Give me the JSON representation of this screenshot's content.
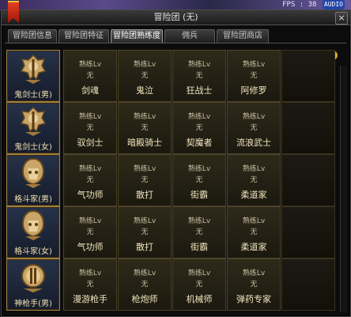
{
  "hud": {
    "fps_label": "FPS : 38",
    "mic_label": "AUDIO"
  },
  "window": {
    "title": "冒险团 (无)",
    "close_glyph": "×",
    "help_glyph": "?"
  },
  "tabs": [
    {
      "label": "冒险团信息",
      "active": false
    },
    {
      "label": "冒险团特征",
      "active": false
    },
    {
      "label": "冒险团熟练度",
      "active": true
    },
    {
      "label": "佣兵",
      "active": false
    },
    {
      "label": "冒险团商店",
      "active": false
    }
  ],
  "lv_label": "熟练Lv",
  "rows": [
    {
      "character": "鬼剑士(男)",
      "emblem": "slayer-emblem-icon",
      "jobs": [
        {
          "name": "剑魂",
          "value": "无"
        },
        {
          "name": "鬼泣",
          "value": "无"
        },
        {
          "name": "狂战士",
          "value": "无"
        },
        {
          "name": "阿修罗",
          "value": "无"
        }
      ]
    },
    {
      "character": "鬼剑士(女)",
      "emblem": "slayer-emblem-icon",
      "jobs": [
        {
          "name": "驭剑士",
          "value": "无"
        },
        {
          "name": "暗殿骑士",
          "value": "无"
        },
        {
          "name": "契魔者",
          "value": "无"
        },
        {
          "name": "流浪武士",
          "value": "无"
        }
      ]
    },
    {
      "character": "格斗家(男)",
      "emblem": "fighter-emblem-icon",
      "jobs": [
        {
          "name": "气功师",
          "value": "无"
        },
        {
          "name": "散打",
          "value": "无"
        },
        {
          "name": "街霸",
          "value": "无"
        },
        {
          "name": "柔道家",
          "value": "无"
        }
      ]
    },
    {
      "character": "格斗家(女)",
      "emblem": "fighter-emblem-icon",
      "jobs": [
        {
          "name": "气功师",
          "value": "无"
        },
        {
          "name": "散打",
          "value": "无"
        },
        {
          "name": "街霸",
          "value": "无"
        },
        {
          "name": "柔道家",
          "value": "无"
        }
      ]
    },
    {
      "character": "神枪手(男)",
      "emblem": "gunner-emblem-icon",
      "jobs": [
        {
          "name": "漫游枪手",
          "value": "无"
        },
        {
          "name": "枪炮师",
          "value": "无"
        },
        {
          "name": "机械师",
          "value": "无"
        },
        {
          "name": "弹药专家",
          "value": "无"
        }
      ]
    }
  ]
}
